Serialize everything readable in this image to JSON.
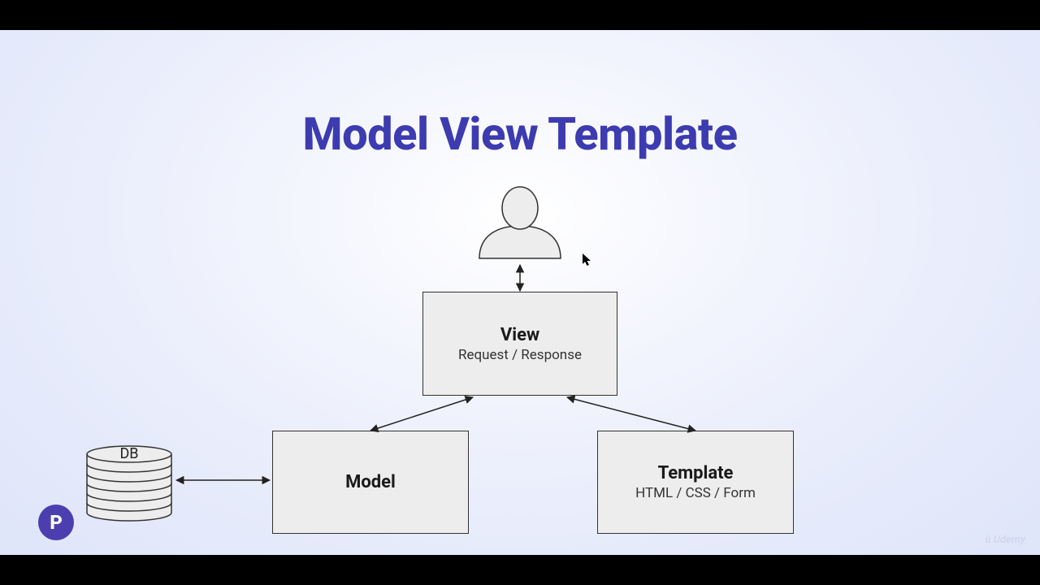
{
  "title": "Model View Template",
  "view": {
    "title": "View",
    "sub": "Request / Response"
  },
  "model": {
    "title": "Model"
  },
  "template": {
    "title": "Template",
    "sub": "HTML / CSS / Form"
  },
  "db_label": "DB",
  "logo_letter": "P",
  "brand": "Udemy"
}
